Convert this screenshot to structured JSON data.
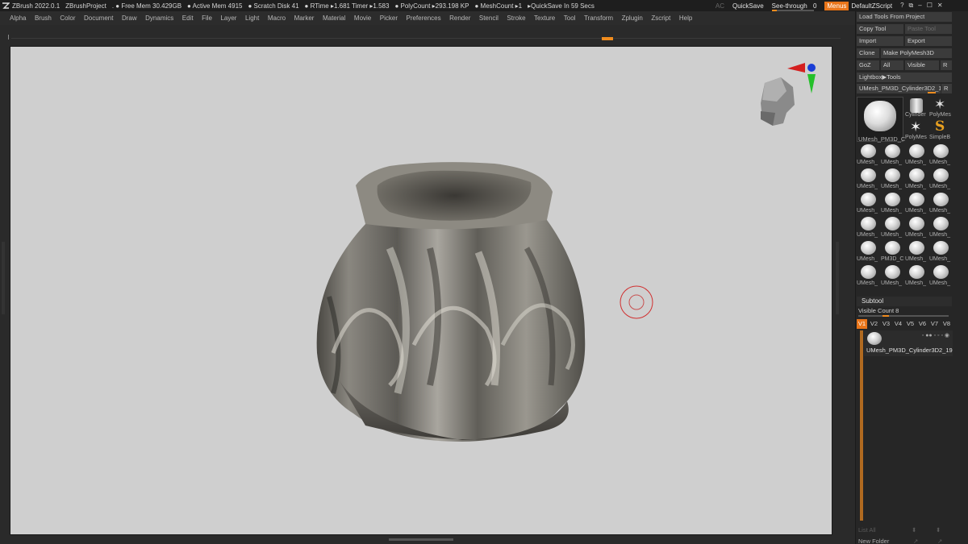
{
  "titlebar": {
    "app": "ZBrush 2022.0.1",
    "project": "ZBrushProject",
    "free_mem": ". ● Free Mem 30.429GB",
    "active_mem": "● Active Mem 4915",
    "scratch": "● Scratch Disk 41",
    "rtime": "● RTime ▸1.681 Timer ▸1.583",
    "polycount": "● PolyCount ▸293.198 KP",
    "meshcount": "● MeshCount ▸1",
    "quicksave_in": "▸QuickSave In 59 Secs",
    "ac": "AC",
    "quicksave": "QuickSave",
    "seethrough_label": "See-through",
    "seethrough_value": "0",
    "menus": "Menus",
    "default_zscript": "DefaultZScript"
  },
  "menubar": [
    "Alpha",
    "Brush",
    "Color",
    "Document",
    "Draw",
    "Dynamics",
    "Edit",
    "File",
    "Layer",
    "Light",
    "Macro",
    "Marker",
    "Material",
    "Movie",
    "Picker",
    "Preferences",
    "Render",
    "Stencil",
    "Stroke",
    "Texture",
    "Tool",
    "Transform",
    "Zplugin",
    "Zscript",
    "Help"
  ],
  "tool_panel": {
    "load_tools": "Load Tools From Project",
    "copy_tool": "Copy Tool",
    "paste_tool": "Paste Tool",
    "import": "Import",
    "export": "Export",
    "clone": "Clone",
    "make_polymesh": "Make PolyMesh3D",
    "goz": "GoZ",
    "all": "All",
    "visible": "Visible",
    "r": "R",
    "lightbox_tools": "Lightbox▶Tools",
    "current_tool": "UMesh_PM3D_Cylinder3D2_1",
    "current_tool_r": "R",
    "main_thumb_label": "UMesh_PM3D_C",
    "cylinder": "Cylinder",
    "polymesh": "PolyMes",
    "polymesh2": "PolyMes",
    "simplebrush": "SimpleB",
    "thumbs": [
      "UMesh_",
      "UMesh_",
      "UMesh_",
      "UMesh_",
      "UMesh_",
      "UMesh_",
      "UMesh_",
      "UMesh_",
      "UMesh_",
      "UMesh_",
      "UMesh_",
      "UMesh_",
      "UMesh_",
      "UMesh_",
      "UMesh_",
      "UMesh_",
      "UMesh_",
      "PM3D_C",
      "UMesh_",
      "UMesh_",
      "UMesh_",
      "UMesh_",
      "UMesh_",
      "UMesh_"
    ]
  },
  "subtool": {
    "header": "Subtool",
    "visible_count": "Visible Count 8",
    "tabs": [
      "V1",
      "V2",
      "V3",
      "V4",
      "V5",
      "V6",
      "V7",
      "V8"
    ],
    "item_name": "UMesh_PM3D_Cylinder3D2_19",
    "list_all": "List All",
    "new_folder": "New Folder"
  },
  "colors": {
    "accent": "#e8751a",
    "canvas_bg": "#cfcfcf",
    "panel_bg": "#262626",
    "brush_cursor": "#d03030"
  }
}
